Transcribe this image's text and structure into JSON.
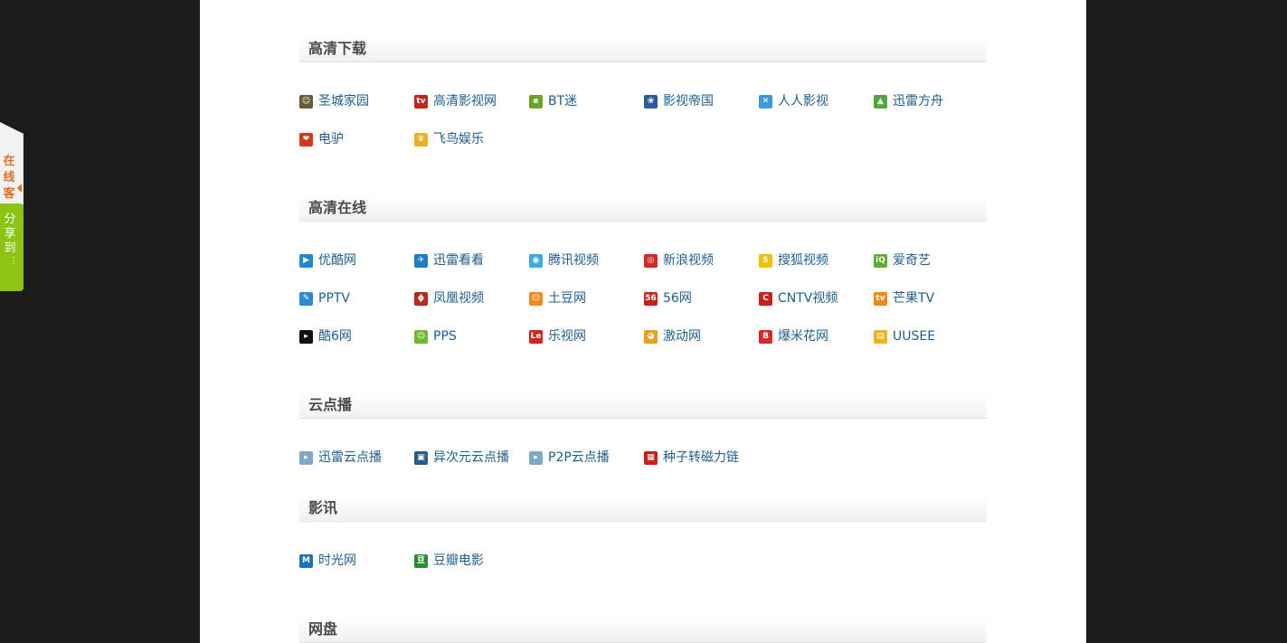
{
  "sidebar": {
    "service_label": "在线客",
    "share_label": "分享到",
    "share_more": "⋮"
  },
  "sections": [
    {
      "title": "高清下载",
      "links": [
        {
          "label": "圣城家园",
          "icon": "shengcheng-icon",
          "color": "#6b5a3a",
          "glyph": "☺"
        },
        {
          "label": "高清影视网",
          "icon": "hdtv-icon",
          "color": "#c0271c",
          "glyph": "tv"
        },
        {
          "label": "BT迷",
          "icon": "btmi-icon",
          "color": "#6aa42a",
          "glyph": "e"
        },
        {
          "label": "影视帝国",
          "icon": "film-reel-icon",
          "color": "#2a5d9a",
          "glyph": "❀"
        },
        {
          "label": "人人影视",
          "icon": "renren-icon",
          "color": "#3b9bd6",
          "glyph": "✕"
        },
        {
          "label": "迅雷方舟",
          "icon": "xunlei-ark-icon",
          "color": "#4fa838",
          "glyph": "▲"
        },
        {
          "label": "电驴",
          "icon": "donkey-icon",
          "color": "#d5361e",
          "glyph": "❤"
        },
        {
          "label": "飞鸟娱乐",
          "icon": "feiniao-icon",
          "color": "#e8b222",
          "glyph": "♛"
        }
      ]
    },
    {
      "title": "高清在线",
      "links": [
        {
          "label": "优酷网",
          "icon": "youku-icon",
          "color": "#1e88d0",
          "glyph": "▶"
        },
        {
          "label": "迅雷看看",
          "icon": "kankan-icon",
          "color": "#1f7dc4",
          "glyph": "✈"
        },
        {
          "label": "腾讯视频",
          "icon": "tencent-video-icon",
          "color": "#3ea8e0",
          "glyph": "◉"
        },
        {
          "label": "新浪视频",
          "icon": "sina-icon",
          "color": "#d52a2a",
          "glyph": "◎"
        },
        {
          "label": "搜狐视频",
          "icon": "sohu-icon",
          "color": "#f2c200",
          "glyph": "S"
        },
        {
          "label": "爱奇艺",
          "icon": "iqiyi-icon",
          "color": "#5cae2c",
          "glyph": "iQ"
        },
        {
          "label": "PPTV",
          "icon": "pptv-icon",
          "color": "#2a8ad6",
          "glyph": "✎"
        },
        {
          "label": "凤凰视频",
          "icon": "ifeng-icon",
          "color": "#b8281f",
          "glyph": "ϕ"
        },
        {
          "label": "土豆网",
          "icon": "tudou-icon",
          "color": "#f08a1f",
          "glyph": "☺"
        },
        {
          "label": "56网",
          "icon": "56-icon",
          "color": "#c8201c",
          "glyph": "56"
        },
        {
          "label": "CNTV视频",
          "icon": "cntv-icon",
          "color": "#c8201c",
          "glyph": "C"
        },
        {
          "label": "芒果TV",
          "icon": "mango-tv-icon",
          "color": "#f08a1f",
          "glyph": "tv"
        },
        {
          "label": "酷6网",
          "icon": "ku6-icon",
          "color": "#111111",
          "glyph": "▸"
        },
        {
          "label": "PPS",
          "icon": "pps-icon",
          "color": "#6dbb2c",
          "glyph": "☺"
        },
        {
          "label": "乐视网",
          "icon": "letv-icon",
          "color": "#d5261d",
          "glyph": "Le"
        },
        {
          "label": "激动网",
          "icon": "joy-icon",
          "color": "#e6a21a",
          "glyph": "◕"
        },
        {
          "label": "爆米花网",
          "icon": "baomihua-icon",
          "color": "#d52a2a",
          "glyph": "B"
        },
        {
          "label": "UUSEE",
          "icon": "uusee-icon",
          "color": "#f2b31c",
          "glyph": "▤"
        }
      ]
    },
    {
      "title": "云点播",
      "links": [
        {
          "label": "迅雷云点播",
          "icon": "cloud-play-icon",
          "color": "#7fa9c9",
          "glyph": "▸"
        },
        {
          "label": "异次元云点播",
          "icon": "picture-icon",
          "color": "#2b5d8c",
          "glyph": "▣"
        },
        {
          "label": "P2P云点播",
          "icon": "p2p-cloud-icon",
          "color": "#7fa9c9",
          "glyph": "▸"
        },
        {
          "label": "种子转磁力链",
          "icon": "magnet-icon",
          "color": "#c8201c",
          "glyph": "▦"
        }
      ]
    },
    {
      "title": "影讯",
      "links": [
        {
          "label": "时光网",
          "icon": "mtime-icon",
          "color": "#1e6fb8",
          "glyph": "M"
        },
        {
          "label": "豆瓣电影",
          "icon": "douban-icon",
          "color": "#2e8a2e",
          "glyph": "豆"
        }
      ]
    },
    {
      "title": "网盘",
      "links": []
    }
  ]
}
